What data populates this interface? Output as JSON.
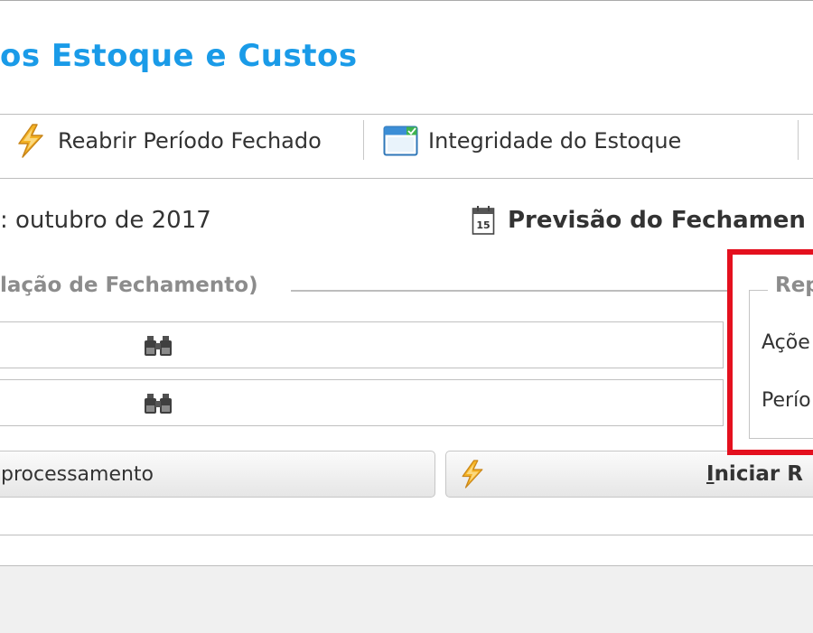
{
  "window": {
    "title": "os Estoque e Custos"
  },
  "toolbar": {
    "reopen_label": "Reabrir Período Fechado",
    "integrity_label": "Integridade do Estoque"
  },
  "period": {
    "text": ": outubro de 2017"
  },
  "forecast": {
    "label": "Previsão do Fechamen"
  },
  "simulation_group": {
    "legend": "lação de Fechamento)"
  },
  "buttons": {
    "processing_label": "processamento",
    "start_label": "Iniciar R",
    "start_mnemonic": "I",
    "start_rest": "niciar R"
  },
  "right_group": {
    "legend": "Rep",
    "action_label": "Açõe",
    "period_label": "Perío"
  },
  "colors": {
    "title_blue": "#1a9be8",
    "highlight_red": "#e4101e",
    "bolt_yellow": "#f5b324"
  },
  "icons": {
    "reopen": "lightning-bolt-icon",
    "integrity": "window-check-icon",
    "calendar": "calendar-15-icon",
    "search": "binoculars-icon"
  }
}
